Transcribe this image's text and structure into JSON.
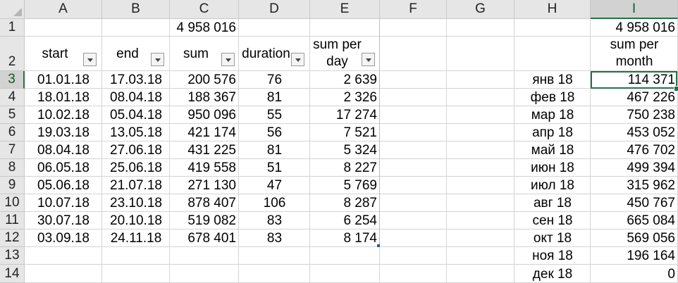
{
  "columns": [
    "A",
    "B",
    "C",
    "D",
    "E",
    "F",
    "G",
    "H",
    "I"
  ],
  "rows": [
    "1",
    "2",
    "3",
    "4",
    "5",
    "6",
    "7",
    "8",
    "9",
    "10",
    "11",
    "12",
    "13",
    "14"
  ],
  "row1": {
    "C": "4 958 016",
    "I": "4 958 016"
  },
  "headers": {
    "A": "start",
    "B": "end",
    "C": "sum",
    "D": "duration",
    "E1": "sum per",
    "E2": "day",
    "I1": "sum per",
    "I2": "month"
  },
  "table": [
    {
      "start": "01.01.18",
      "end": "17.03.18",
      "sum": "200 576",
      "duration": "76",
      "per_day": "2 639"
    },
    {
      "start": "18.01.18",
      "end": "08.04.18",
      "sum": "188 367",
      "duration": "81",
      "per_day": "2 326"
    },
    {
      "start": "10.02.18",
      "end": "05.04.18",
      "sum": "950 096",
      "duration": "55",
      "per_day": "17 274"
    },
    {
      "start": "19.03.18",
      "end": "13.05.18",
      "sum": "421 174",
      "duration": "56",
      "per_day": "7 521"
    },
    {
      "start": "08.04.18",
      "end": "27.06.18",
      "sum": "431 225",
      "duration": "81",
      "per_day": "5 324"
    },
    {
      "start": "06.05.18",
      "end": "25.06.18",
      "sum": "419 558",
      "duration": "51",
      "per_day": "8 227"
    },
    {
      "start": "05.06.18",
      "end": "21.07.18",
      "sum": "271 130",
      "duration": "47",
      "per_day": "5 769"
    },
    {
      "start": "10.07.18",
      "end": "23.10.18",
      "sum": "878 407",
      "duration": "106",
      "per_day": "8 287"
    },
    {
      "start": "30.07.18",
      "end": "20.10.18",
      "sum": "519 082",
      "duration": "83",
      "per_day": "6 254"
    },
    {
      "start": "03.09.18",
      "end": "24.11.18",
      "sum": "678 401",
      "duration": "83",
      "per_day": "8 174"
    }
  ],
  "monthly": [
    {
      "month": "янв 18",
      "value": "114 371"
    },
    {
      "month": "фев 18",
      "value": "467 226"
    },
    {
      "month": "мар 18",
      "value": "750 238"
    },
    {
      "month": "апр 18",
      "value": "453 052"
    },
    {
      "month": "май 18",
      "value": "476 702"
    },
    {
      "month": "июн 18",
      "value": "499 394"
    },
    {
      "month": "июл 18",
      "value": "315 962"
    },
    {
      "month": "авг 18",
      "value": "450 767"
    },
    {
      "month": "сен 18",
      "value": "665 084"
    },
    {
      "month": "окт 18",
      "value": "569 056"
    },
    {
      "month": "ноя 18",
      "value": "196 164"
    },
    {
      "month": "дек 18",
      "value": "0"
    }
  ],
  "selected": {
    "column": "I",
    "row": "3"
  },
  "colors": {
    "accent": "#217346",
    "header_bg": "#e6e6e6",
    "gridline": "#d4d4d4"
  }
}
